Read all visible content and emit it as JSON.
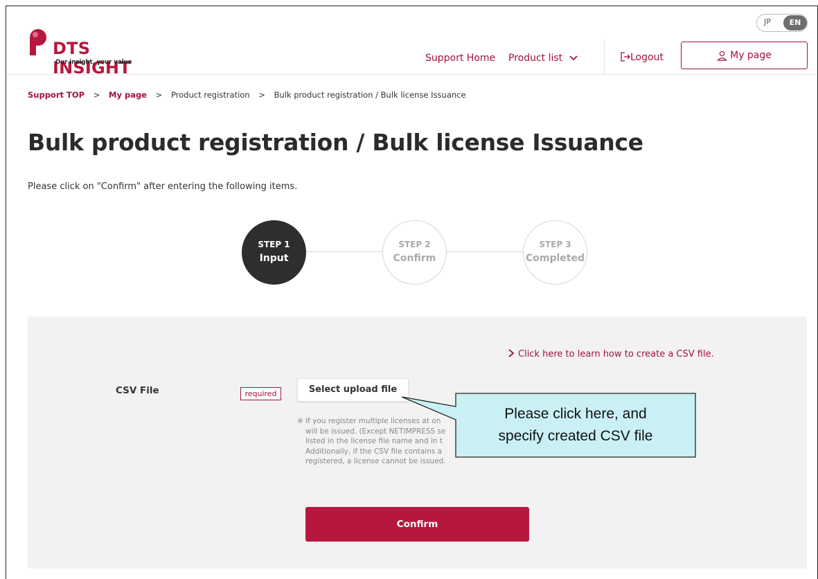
{
  "header": {
    "logo_name": "DTS INSIGHT",
    "logo_tagline": "Our insight, your value",
    "lang": {
      "jp": "JP",
      "en": "EN",
      "active": "EN"
    },
    "nav": {
      "support_home": "Support Home",
      "product_list": "Product list",
      "logout": "Logout",
      "my_page": "My page"
    }
  },
  "breadcrumb": {
    "items": [
      "Support TOP",
      "My page",
      "Product registration",
      "Bulk product registration / Bulk license Issuance"
    ],
    "separator": ">"
  },
  "page_title": "Bulk product registration / Bulk license Issuance",
  "instruction": "Please click on \"Confirm\" after entering the following items.",
  "steps": [
    {
      "num": "STEP 1",
      "name": "Input",
      "active": true
    },
    {
      "num": "STEP 2",
      "name": "Confirm",
      "active": false
    },
    {
      "num": "STEP 3",
      "name": "Completed",
      "active": false
    }
  ],
  "form": {
    "csv_help_link": "Click here to learn how to create a CSV file.",
    "field_label": "CSV File",
    "required_badge": "required",
    "upload_button": "Select upload file",
    "note_lines": [
      "※ If you register multiple licenses at on",
      "will be issued. (Except NETIMPRESS se",
      "listed in the license file name and in t",
      "Additionally, if the CSV file contains a",
      "registered, a license cannot be issued."
    ],
    "confirm_button": "Confirm"
  },
  "callout": {
    "line1": "Please click here, and",
    "line2": "specify created CSV file"
  },
  "colors": {
    "brand": "#b8173d",
    "link": "#a3123a",
    "active_step": "#2e2e2e",
    "panel_bg": "#f2f2f2",
    "callout_bg": "#c9f1f5"
  }
}
